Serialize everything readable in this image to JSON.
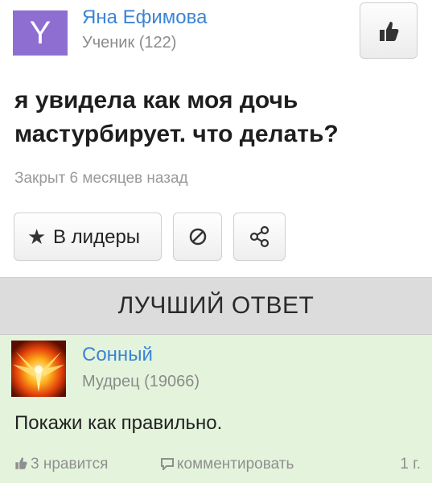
{
  "question": {
    "author_initial": "Y",
    "author_name": "Яна Ефимова",
    "author_rank": "Ученик (122)",
    "title": "я увидела как моя дочь мастурбирует. что делать?",
    "status": "Закрыт 6 месяцев назад",
    "leaders_label": "В лидеры",
    "avatar_color": "#8e6fd1"
  },
  "best_answer": {
    "header": "ЛУЧШИЙ ОТВЕТ",
    "author_name": "Сонный",
    "author_rank": "Мудрец (19066)",
    "text": "Покажи как правильно.",
    "likes": "3 нравится",
    "comment_label": "комментировать",
    "age": "1 г.",
    "background": "#e4f4dc"
  },
  "icons": [
    "thumbs-up-icon",
    "star-icon",
    "block-icon",
    "share-icon",
    "comment-icon",
    "phoenix-avatar"
  ],
  "colors": {
    "link": "#3b84d6",
    "muted": "#8b8b8b",
    "header_bg": "#dcdcdc"
  }
}
